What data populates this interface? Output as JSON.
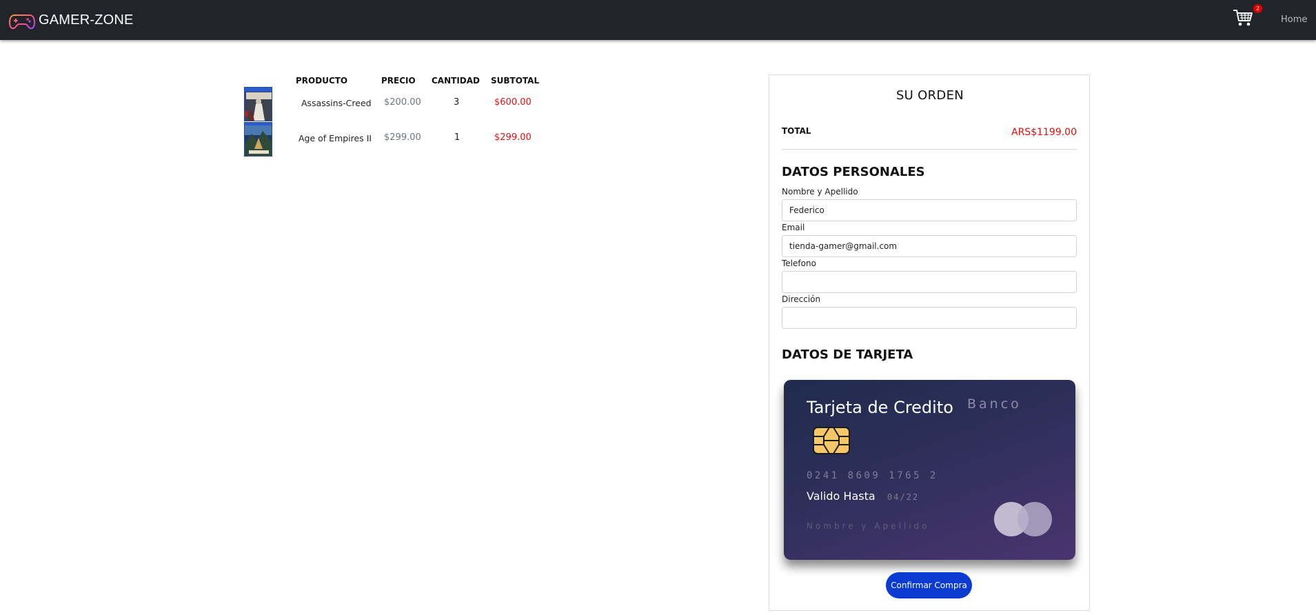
{
  "navbar": {
    "brand": "GAMER-ZONE",
    "brand_icon": "gamepad-icon",
    "cart_icon": "shopping-cart-icon",
    "cart_count": "2",
    "home_label": "Home"
  },
  "cart_table": {
    "headers": {
      "producto": "PRODUCTO",
      "precio": "PRECIO",
      "cantidad": "CANTIDAD",
      "subtotal": "SUBTOTAL"
    },
    "rows": [
      {
        "name": "Assassins-Creed",
        "price": "$200.00",
        "quantity": "3",
        "subtotal": "$600.00"
      },
      {
        "name": "Age of Empires II",
        "price": "$299.00",
        "quantity": "1",
        "subtotal": "$299.00"
      }
    ]
  },
  "order": {
    "title": "SU ORDEN",
    "total_label": "TOTAL",
    "total_value": "ARS$1199.00",
    "personal_title": "DATOS PERSONALES",
    "fields": {
      "nombre_label": "Nombre y Apellido",
      "nombre_value": "Federico",
      "email_label": "Email",
      "email_value": "tienda-gamer@gmail.com",
      "telefono_label": "Telefono",
      "telefono_value": "",
      "direccion_label": "Dirección",
      "direccion_value": ""
    },
    "card_title_section": "DATOS DE TARJETA",
    "card": {
      "title": "Tarjeta de Credito",
      "bank": "Banco",
      "number": "0241 8609 1765 2",
      "valid_label": "Valido Hasta",
      "valid_value": "04/22",
      "holder": "Nombre y Apellido",
      "chip_icon": "card-chip-icon",
      "logo_icon": "card-brand-circles-icon"
    },
    "confirm_label": "Confirmar Compra"
  },
  "colors": {
    "navbar_bg": "#212529",
    "accent_red": "#e01010",
    "confirm_button": "#0b3bd0",
    "card_gradient_start": "#1f2b4d",
    "card_gradient_end": "#4a3470"
  }
}
